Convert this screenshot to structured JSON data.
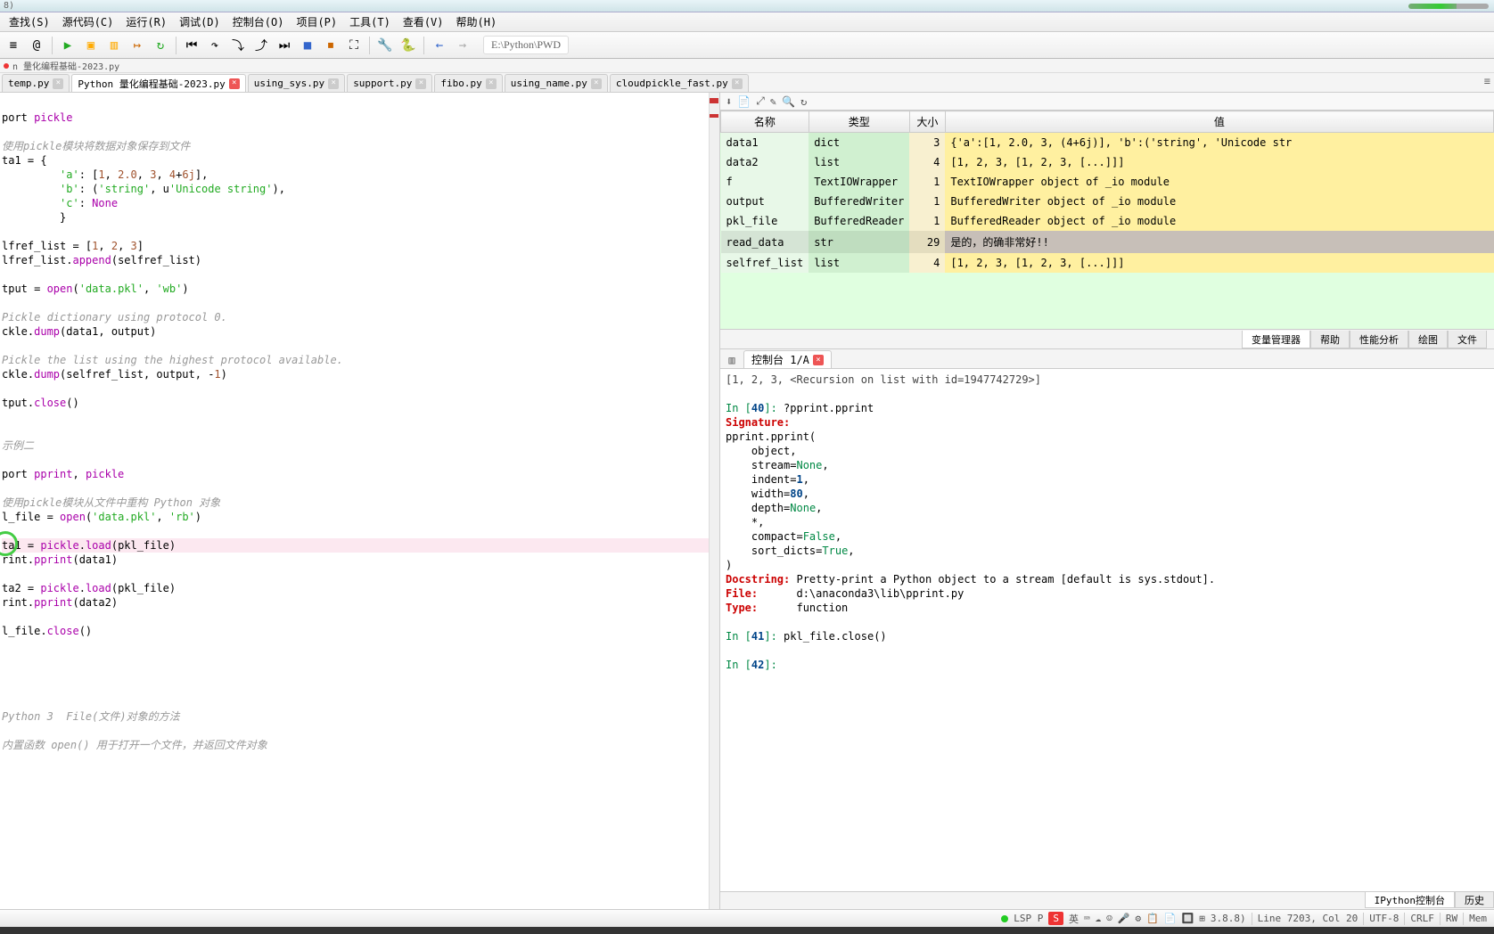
{
  "titlebar_text": "8)",
  "menus": [
    "查找(S)",
    "源代码(C)",
    "运行(R)",
    "调试(D)",
    "控制台(O)",
    "项目(P)",
    "工具(T)",
    "查看(V)",
    "帮助(H)"
  ],
  "toolbar_path": "E:\\Python\\PWD",
  "toolbar_icons": [
    {
      "name": "menu-icon",
      "glyph": "≡"
    },
    {
      "name": "at-icon",
      "glyph": "@"
    },
    {
      "sep": true
    },
    {
      "name": "run-icon",
      "glyph": "▶",
      "color": "#2a2"
    },
    {
      "name": "run-cell-icon",
      "glyph": "▣",
      "color": "#fa0"
    },
    {
      "name": "run-cell-next-icon",
      "glyph": "▥",
      "color": "#fa0"
    },
    {
      "name": "run-selection-icon",
      "glyph": "↦",
      "color": "#c60"
    },
    {
      "name": "restart-icon",
      "glyph": "↻",
      "color": "#2a2"
    },
    {
      "sep": true
    },
    {
      "name": "debug-start-icon",
      "glyph": "⏮"
    },
    {
      "name": "step-over-icon",
      "glyph": "↷"
    },
    {
      "name": "step-in-icon",
      "glyph": "⤵"
    },
    {
      "name": "step-out-icon",
      "glyph": "⤴"
    },
    {
      "name": "continue-icon",
      "glyph": "⏭"
    },
    {
      "name": "stop-icon",
      "glyph": "■",
      "color": "#36c"
    },
    {
      "name": "exit-debug-icon",
      "glyph": "⏹",
      "color": "#c60"
    },
    {
      "name": "maximize-icon",
      "glyph": "⛶"
    },
    {
      "sep": true
    },
    {
      "name": "wrench-icon",
      "glyph": "🔧"
    },
    {
      "name": "python-icon",
      "glyph": "🐍"
    },
    {
      "sep": true
    },
    {
      "name": "nav-back-icon",
      "glyph": "←",
      "color": "#36c"
    },
    {
      "name": "nav-fwd-icon",
      "glyph": "→",
      "color": "#aaa"
    }
  ],
  "file_header": "n 量化编程基础-2023.py",
  "file_tabs": [
    {
      "label": "temp.py",
      "active": false
    },
    {
      "label": "Python 量化编程基础-2023.py",
      "active": true
    },
    {
      "label": "using_sys.py",
      "active": false
    },
    {
      "label": "support.py",
      "active": false
    },
    {
      "label": "fibo.py",
      "active": false
    },
    {
      "label": "using_name.py",
      "active": false
    },
    {
      "label": "cloudpickle_fast.py",
      "active": false
    }
  ],
  "code": [
    "",
    "port pickle",
    "",
    "使用pickle模块将数据对象保存到文件",
    "ta1 = {",
    "         'a': [1, 2.0, 3, 4+6j],",
    "         'b': ('string', u'Unicode string'),",
    "         'c': None",
    "         }",
    "",
    "lfref_list = [1, 2, 3]",
    "lfref_list.append(selfref_list)",
    "",
    "tput = open('data.pkl', 'wb')",
    "",
    "Pickle dictionary using protocol 0.",
    "ckle.dump(data1, output)",
    "",
    "Pickle the list using the highest protocol available.",
    "ckle.dump(selfref_list, output, -1)",
    "",
    "tput.close()",
    "",
    "",
    "示例二",
    "",
    "port pprint, pickle",
    "",
    "使用pickle模块从文件中重构 Python 对象",
    "l_file = open('data.pkl', 'rb')",
    "",
    "ta1 = pickle.load(pkl_file)",
    "rint.pprint(data1)",
    "",
    "ta2 = pickle.load(pkl_file)",
    "rint.pprint(data2)",
    "",
    "l_file.close()",
    "",
    "",
    "",
    "",
    "",
    "Python 3  File(文件)对象的方法",
    "",
    "内置函数 open() 用于打开一个文件，并返回文件对象"
  ],
  "code_comment_lines": [
    3,
    15,
    18,
    24,
    28,
    43,
    45
  ],
  "code_hl_line": 31,
  "right_toolbar_icons": [
    {
      "name": "save-icon",
      "glyph": "⬇"
    },
    {
      "name": "save-all-icon",
      "glyph": "📄"
    },
    {
      "name": "fit-icon",
      "glyph": "⤢"
    },
    {
      "name": "edit-icon",
      "glyph": "✎"
    },
    {
      "name": "search-icon",
      "glyph": "🔍"
    },
    {
      "name": "refresh-icon",
      "glyph": "↻"
    }
  ],
  "var_headers": [
    "名称",
    "类型",
    "大小",
    "值"
  ],
  "variables": [
    {
      "name": "data1",
      "type": "dict",
      "size": "3",
      "value": "{'a':[1, 2.0, 3, (4+6j)], 'b':('string', 'Unicode str"
    },
    {
      "name": "data2",
      "type": "list",
      "size": "4",
      "value": "[1, 2, 3, [1, 2, 3, [...]]]"
    },
    {
      "name": "f",
      "type": "TextIOWrapper",
      "size": "1",
      "value": "TextIOWrapper object of _io module"
    },
    {
      "name": "output",
      "type": "BufferedWriter",
      "size": "1",
      "value": "BufferedWriter object of _io module"
    },
    {
      "name": "pkl_file",
      "type": "BufferedReader",
      "size": "1",
      "value": "BufferedReader object of _io module"
    },
    {
      "name": "read_data",
      "type": "str",
      "size": "29",
      "value": "是的，的确非常好!!",
      "sel": true
    },
    {
      "name": "selfref_list",
      "type": "list",
      "size": "4",
      "value": "[1, 2, 3, [1, 2, 3, [...]]]"
    }
  ],
  "var_tabs": [
    "变量管理器",
    "帮助",
    "性能分析",
    "绘图",
    "文件"
  ],
  "var_tab_active": 0,
  "console_tab": "控制台 1/A",
  "console": {
    "top_frag": "[1, 2, 3, <Recursion on list with id=1947742729>]",
    "lines": [
      {
        "t": "in",
        "n": "40",
        "txt": "?pprint.pprint"
      },
      {
        "t": "hdr",
        "label": "Signature:",
        "body": ""
      },
      {
        "t": "plain",
        "txt": "pprint.pprint("
      },
      {
        "t": "plain",
        "txt": "    object,"
      },
      {
        "t": "kv",
        "k": "    stream=",
        "v": "None",
        "post": ","
      },
      {
        "t": "kv",
        "k": "    indent=",
        "v": "1",
        "num": true,
        "post": ","
      },
      {
        "t": "kv",
        "k": "    width=",
        "v": "80",
        "num": true,
        "post": ","
      },
      {
        "t": "kv",
        "k": "    depth=",
        "v": "None",
        "post": ","
      },
      {
        "t": "plain",
        "txt": "    *,"
      },
      {
        "t": "kv",
        "k": "    compact=",
        "v": "False",
        "post": ","
      },
      {
        "t": "kv",
        "k": "    sort_dicts=",
        "v": "True",
        "post": ","
      },
      {
        "t": "plain",
        "txt": ")"
      },
      {
        "t": "hdr",
        "label": "Docstring:",
        "body": " Pretty-print a Python object to a stream [default is sys.stdout]."
      },
      {
        "t": "hdr",
        "label": "File:     ",
        "body": " d:\\anaconda3\\lib\\pprint.py"
      },
      {
        "t": "hdr",
        "label": "Type:     ",
        "body": " function"
      },
      {
        "t": "blank"
      },
      {
        "t": "in",
        "n": "41",
        "txt": "pkl_file.close()"
      },
      {
        "t": "blank"
      },
      {
        "t": "in",
        "n": "42",
        "txt": ""
      }
    ]
  },
  "console_bottom_tabs": [
    "IPython控制台",
    "历史"
  ],
  "console_bottom_active": 0,
  "status": {
    "lsp": "LSP P",
    "ime_badge": "S",
    "ime_lang": "英",
    "icons": [
      "⌨",
      "☁",
      "☺",
      "🎤",
      "⚙",
      "📋",
      "📄",
      "🔲",
      "⊞"
    ],
    "version": "3.8.8)",
    "line": "Line 7203, Col 20",
    "encoding": "UTF-8",
    "eol": "CRLF",
    "perm": "RW",
    "mem": "Mem"
  }
}
